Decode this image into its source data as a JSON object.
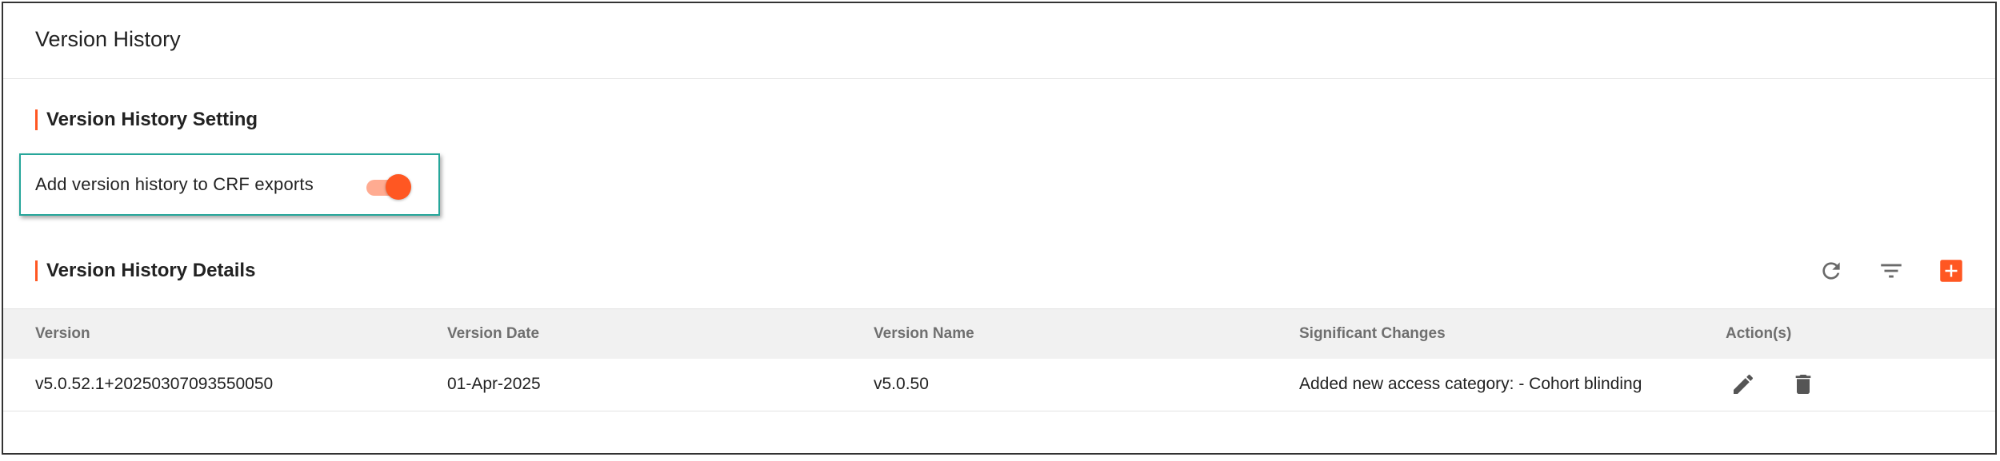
{
  "page": {
    "title": "Version History"
  },
  "setting_section": {
    "heading": "Version History Setting",
    "toggle_label": "Add version history to CRF exports",
    "toggle_on": true
  },
  "details_section": {
    "heading": "Version History Details",
    "toolbar": {
      "refresh_icon": "refresh-icon",
      "filter_icon": "filter-icon",
      "add_icon": "add-icon"
    }
  },
  "table": {
    "columns": [
      "Version",
      "Version Date",
      "Version Name",
      "Significant Changes",
      "Action(s)"
    ],
    "rows": [
      {
        "version": "v5.0.52.1+20250307093550050",
        "version_date": "01-Apr-2025",
        "version_name": "v5.0.50",
        "significant_changes": "Added new access category: - Cohort blinding",
        "actions": [
          "edit-icon",
          "delete-icon"
        ]
      }
    ]
  },
  "colors": {
    "accent": "#ff5722",
    "highlight_border": "#26a69a",
    "header_bg": "#f1f1f1"
  }
}
